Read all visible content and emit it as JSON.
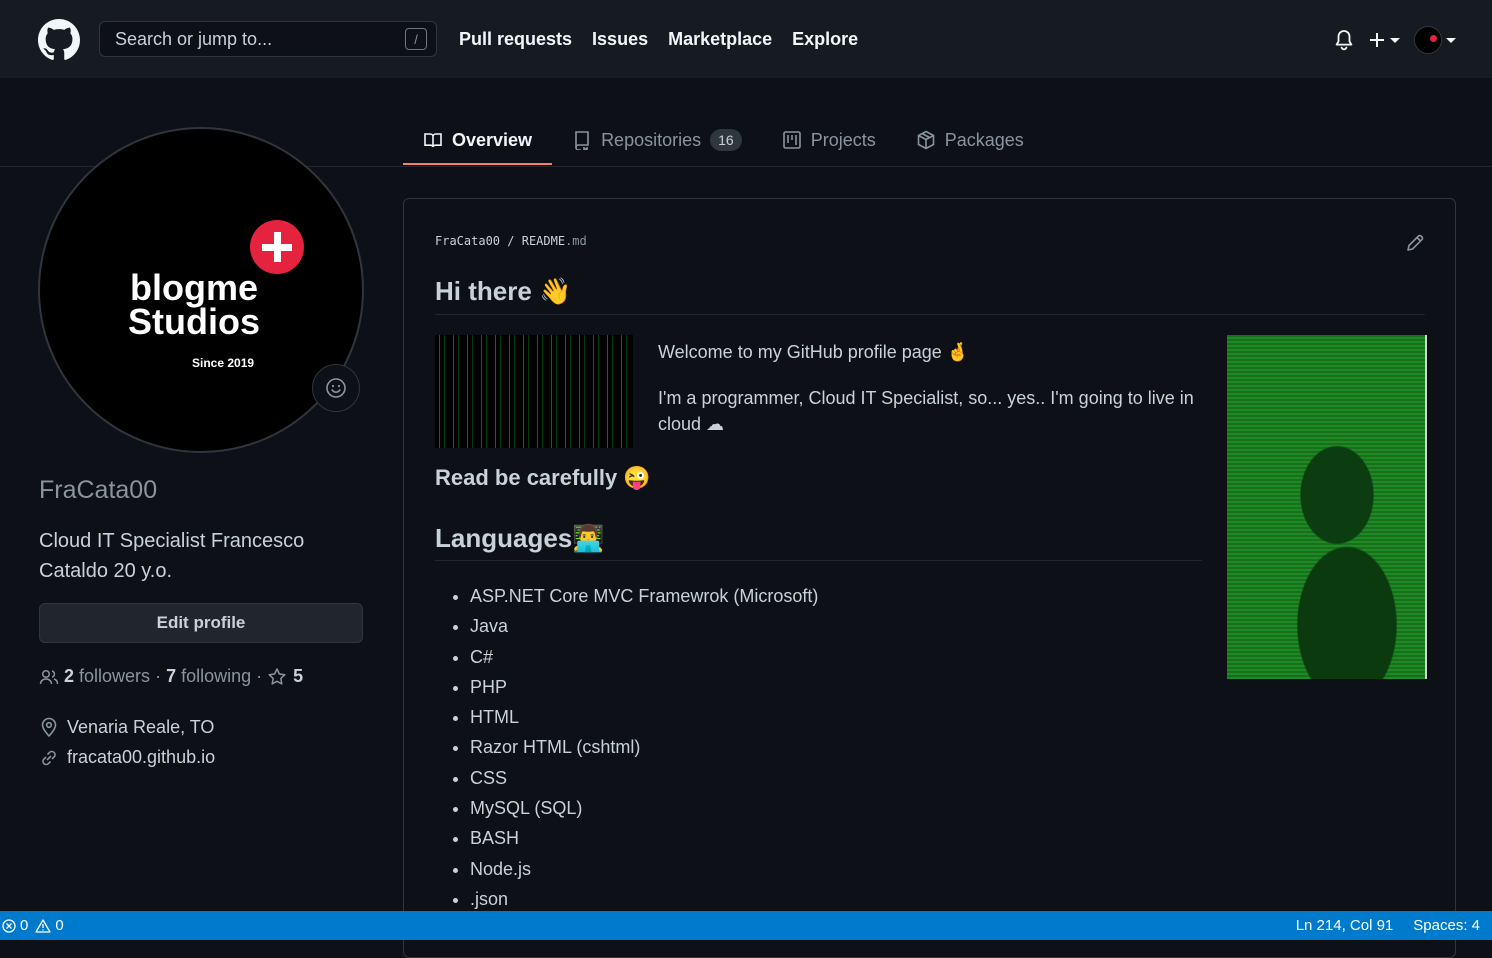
{
  "header": {
    "search_placeholder": "Search or jump to...",
    "search_shortcut": "/",
    "nav": [
      "Pull requests",
      "Issues",
      "Marketplace",
      "Explore"
    ]
  },
  "tabs": [
    {
      "label": "Overview",
      "icon": "book-icon"
    },
    {
      "label": "Repositories",
      "icon": "repo-icon",
      "count": "16"
    },
    {
      "label": "Projects",
      "icon": "project-icon"
    },
    {
      "label": "Packages",
      "icon": "package-icon"
    }
  ],
  "profile": {
    "avatar_text": {
      "line1": "blogme",
      "line2": "Studios",
      "since": "Since 2019"
    },
    "username": "FraCata00",
    "bio": "Cloud IT Specialist Francesco Cataldo 20 y.o.",
    "edit_button": "Edit profile",
    "followers_count": "2",
    "followers_label": "followers",
    "following_count": "7",
    "following_label": "following",
    "stars_count": "5",
    "location": "Venaria Reale, TO",
    "website": "fracata00.github.io"
  },
  "readme": {
    "owner": "FraCata00",
    "file": "README",
    "ext": ".md",
    "heading": "Hi there",
    "heading_emoji": "👋",
    "welcome_line": "Welcome to my GitHub profile page 🤞",
    "intro_line": "I'm a programmer, Cloud IT Specialist, so... yes.. I'm going to live in cloud ☁",
    "read_heading": "Read be carefully",
    "read_emoji": "😜",
    "languages_heading": "Languages",
    "languages_emoji": "👨‍💻",
    "languages": [
      "ASP.NET Core MVC Framewrok (Microsoft)",
      "Java",
      "C#",
      "PHP",
      "HTML",
      "Razor HTML (cshtml)",
      "CSS",
      "MySQL (SQL)",
      "BASH",
      "Node.js",
      ".json"
    ]
  },
  "statusbar": {
    "errors": "0",
    "warnings": "0",
    "position": "Ln 214, Col 91",
    "spaces": "Spaces: 4"
  },
  "colors": {
    "background": "#0d1117",
    "header": "#161b22",
    "tab_underline": "#f78166",
    "brand_red": "#e5233f",
    "statusbar": "#007acc"
  }
}
